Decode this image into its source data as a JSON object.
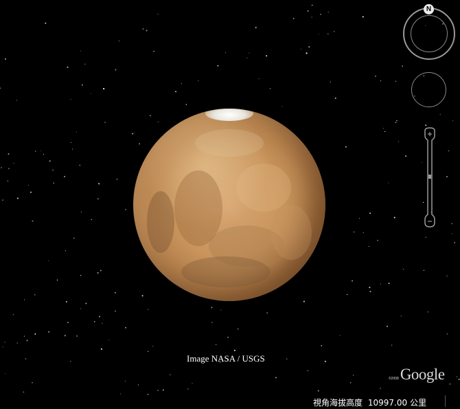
{
  "viewer": {
    "image_credit": "Image NASA / USGS",
    "logo": {
      "copyright": "©2008",
      "wordmark": "Google"
    },
    "status_bar": {
      "label": "視角海拔高度",
      "value": "10997.00",
      "unit": "公里"
    }
  },
  "navigation": {
    "north_label": "N"
  },
  "colors": {
    "background": "#000000",
    "planet": "#c9955d",
    "controls": "#9a9a9a"
  }
}
